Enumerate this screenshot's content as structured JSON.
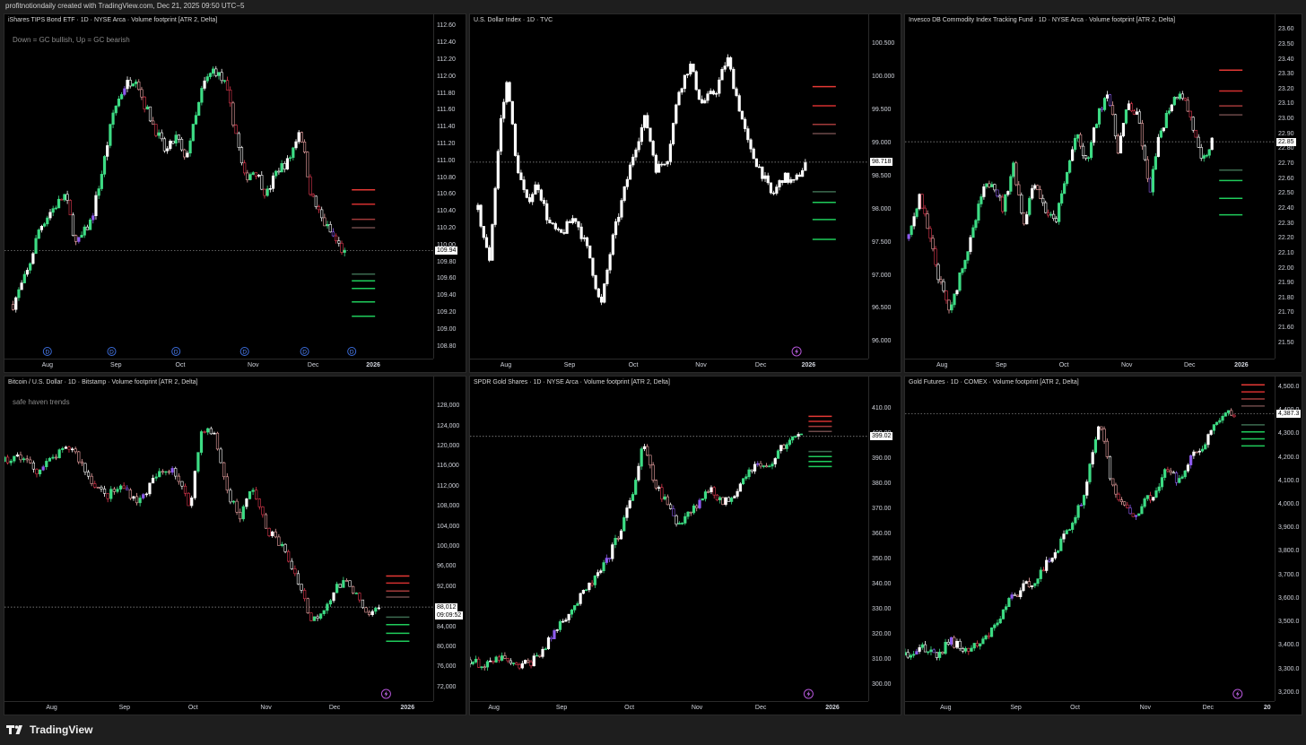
{
  "header": {
    "text": "profitnotiondaily created with TradingView.com, Dec 21, 2025 09:50 UTC−5"
  },
  "footer": {
    "brand": "TradingView"
  },
  "colors": {
    "bull": "#3ddc84",
    "bear": "#f2a7a7",
    "neutral": "#ffffff",
    "red_level": "#e53935",
    "green_level": "#1fcc5b",
    "purple": "#8e5cf0"
  },
  "panels": [
    {
      "id": "tip",
      "title": "iShares TIPS Bond ETF · 1D · NYSE Arca · Volume footprint [ATR 2, Delta]",
      "note": "Down = GC  bullish, Up =  GC bearish",
      "y_labels": [
        "112.60",
        "112.40",
        "112.20",
        "112.00",
        "111.80",
        "111.60",
        "111.40",
        "111.20",
        "111.00",
        "110.80",
        "110.60",
        "110.40",
        "110.20",
        "110.00",
        "109.80",
        "109.60",
        "109.40",
        "109.20",
        "109.00",
        "108.80"
      ],
      "price": "109.94",
      "x_labels": [
        "Aug",
        "Sep",
        "Oct",
        "Nov",
        "Dec",
        "2026"
      ],
      "marker_labels": [
        "D",
        "D",
        "D",
        "D",
        "D",
        "D"
      ]
    },
    {
      "id": "dxy",
      "title": "U.S. Dollar Index · 1D · TVC",
      "note": "",
      "y_labels": [
        "100.500",
        "100.000",
        "99.500",
        "99.000",
        "98.500",
        "98.000",
        "97.500",
        "97.000",
        "96.500",
        "96.000"
      ],
      "price": "98.718",
      "x_labels": [
        "Aug",
        "Sep",
        "Oct",
        "Nov",
        "Dec",
        "2026"
      ],
      "marker_labels": []
    },
    {
      "id": "dbc",
      "title": "Invesco DB Commodity Index Tracking Fund · 1D · NYSE Arca · Volume footprint [ATR 2, Delta]",
      "note": "",
      "y_labels": [
        "23.60",
        "23.50",
        "23.40",
        "23.30",
        "23.20",
        "23.10",
        "23.00",
        "22.90",
        "22.80",
        "22.70",
        "22.60",
        "22.50",
        "22.40",
        "22.30",
        "22.20",
        "22.10",
        "22.00",
        "21.90",
        "21.80",
        "21.70",
        "21.60",
        "21.50"
      ],
      "price": "22.85",
      "x_labels": [
        "Aug",
        "Sep",
        "Oct",
        "Nov",
        "Dec",
        "2026"
      ],
      "marker_labels": []
    },
    {
      "id": "btc",
      "title": "Bitcoin / U.S. Dollar · 1D · Bitstamp · Volume footprint [ATR 2, Delta]",
      "note": "safe haven trends",
      "y_labels": [
        "128,000",
        "124,000",
        "120,000",
        "116,000",
        "112,000",
        "108,000",
        "104,000",
        "100,000",
        "96,000",
        "92,000",
        "88,000",
        "84,000",
        "80,000",
        "76,000",
        "72,000"
      ],
      "price": "88,012",
      "countdown": "09:09:52",
      "x_labels": [
        "Aug",
        "Sep",
        "Oct",
        "Nov",
        "Dec",
        "2026"
      ],
      "marker_labels": []
    },
    {
      "id": "gld",
      "title": "SPDR Gold Shares · 1D · NYSE Arca · Volume footprint [ATR 2, Delta]",
      "note": "",
      "y_labels": [
        "410.00",
        "400.00",
        "390.00",
        "380.00",
        "370.00",
        "360.00",
        "350.00",
        "340.00",
        "330.00",
        "320.00",
        "310.00",
        "300.00"
      ],
      "price": "399.02",
      "x_labels": [
        "Aug",
        "Sep",
        "Oct",
        "Nov",
        "Dec",
        "2026"
      ],
      "marker_labels": []
    },
    {
      "id": "gc",
      "title": "Gold Futures · 1D · COMEX · Volume footprint [ATR 2, Delta]",
      "note": "",
      "y_labels": [
        "4,500.0",
        "4,400.0",
        "4,300.0",
        "4,200.0",
        "4,100.0",
        "4,000.0",
        "3,900.0",
        "3,800.0",
        "3,700.0",
        "3,600.0",
        "3,500.0",
        "3,400.0",
        "3,300.0",
        "3,200.0"
      ],
      "price": "4,387.3",
      "x_labels": [
        "Aug",
        "Sep",
        "Oct",
        "Nov",
        "Dec",
        "20"
      ],
      "marker_labels": []
    }
  ],
  "chart_data": [
    {
      "type": "candlestick",
      "title": "iShares TIPS Bond ETF · 1D · NYSE Arca · Volume footprint [ATR 2, Delta]",
      "ylim": [
        108.7,
        112.7
      ],
      "x_labels": [
        "Aug",
        "Sep",
        "Oct",
        "Nov",
        "Dec",
        "2026"
      ],
      "last_price": 109.94,
      "path": [
        [
          0,
          109.3
        ],
        [
          0.04,
          109.7
        ],
        [
          0.07,
          110.2
        ],
        [
          0.1,
          110.4
        ],
        [
          0.14,
          110.6
        ],
        [
          0.17,
          110.0
        ],
        [
          0.21,
          110.3
        ],
        [
          0.24,
          110.9
        ],
        [
          0.27,
          111.6
        ],
        [
          0.3,
          111.9
        ],
        [
          0.33,
          112.0
        ],
        [
          0.35,
          111.7
        ],
        [
          0.38,
          111.4
        ],
        [
          0.41,
          111.1
        ],
        [
          0.44,
          111.3
        ],
        [
          0.46,
          111.0
        ],
        [
          0.49,
          111.5
        ],
        [
          0.51,
          111.9
        ],
        [
          0.54,
          112.1
        ],
        [
          0.57,
          111.9
        ],
        [
          0.6,
          111.3
        ],
        [
          0.62,
          110.8
        ],
        [
          0.65,
          110.9
        ],
        [
          0.68,
          110.6
        ],
        [
          0.71,
          110.9
        ],
        [
          0.74,
          111.0
        ],
        [
          0.77,
          111.4
        ],
        [
          0.8,
          110.6
        ],
        [
          0.83,
          110.3
        ],
        [
          0.86,
          110.1
        ],
        [
          0.89,
          109.9
        ]
      ],
      "levels": {
        "red": [
          110.66,
          110.49,
          110.31,
          110.21
        ],
        "green": [
          109.66,
          109.58,
          109.49,
          109.33,
          109.16
        ]
      }
    },
    {
      "type": "candlestick",
      "title": "U.S. Dollar Index · 1D · TVC",
      "ylim": [
        95.8,
        100.9
      ],
      "x_labels": [
        "Aug",
        "Sep",
        "Oct",
        "Nov",
        "Dec",
        "2026"
      ],
      "last_price": 98.718,
      "path": [
        [
          0,
          98.0
        ],
        [
          0.03,
          97.2
        ],
        [
          0.06,
          99.3
        ],
        [
          0.08,
          100.0
        ],
        [
          0.1,
          98.8
        ],
        [
          0.13,
          98.1
        ],
        [
          0.16,
          98.4
        ],
        [
          0.19,
          97.8
        ],
        [
          0.22,
          97.6
        ],
        [
          0.26,
          97.9
        ],
        [
          0.3,
          97.3
        ],
        [
          0.33,
          96.5
        ],
        [
          0.36,
          97.5
        ],
        [
          0.39,
          98.2
        ],
        [
          0.42,
          98.9
        ],
        [
          0.45,
          99.4
        ],
        [
          0.48,
          98.6
        ],
        [
          0.51,
          98.8
        ],
        [
          0.54,
          99.8
        ],
        [
          0.57,
          100.2
        ],
        [
          0.6,
          99.6
        ],
        [
          0.64,
          99.8
        ],
        [
          0.67,
          100.3
        ],
        [
          0.7,
          99.6
        ],
        [
          0.73,
          98.9
        ],
        [
          0.76,
          98.6
        ],
        [
          0.79,
          98.2
        ],
        [
          0.82,
          98.5
        ],
        [
          0.85,
          98.4
        ],
        [
          0.88,
          98.7
        ]
      ],
      "levels": {
        "red": [
          99.86,
          99.57,
          99.29,
          99.15
        ],
        "green": [
          98.27,
          98.11,
          97.85,
          97.55
        ]
      }
    },
    {
      "type": "candlestick",
      "title": "Invesco DB Commodity Index Tracking Fund · 1D · NYSE Arca · Volume footprint [ATR 2, Delta]",
      "ylim": [
        21.42,
        23.68
      ],
      "x_labels": [
        "Aug",
        "Sep",
        "Oct",
        "Nov",
        "Dec",
        "2026"
      ],
      "last_price": 22.85,
      "path": [
        [
          0,
          22.2
        ],
        [
          0.03,
          22.5
        ],
        [
          0.06,
          22.2
        ],
        [
          0.09,
          21.9
        ],
        [
          0.12,
          21.7
        ],
        [
          0.15,
          22.0
        ],
        [
          0.18,
          22.2
        ],
        [
          0.21,
          22.5
        ],
        [
          0.24,
          22.6
        ],
        [
          0.27,
          22.4
        ],
        [
          0.3,
          22.7
        ],
        [
          0.33,
          22.3
        ],
        [
          0.36,
          22.6
        ],
        [
          0.39,
          22.4
        ],
        [
          0.42,
          22.3
        ],
        [
          0.45,
          22.6
        ],
        [
          0.48,
          22.9
        ],
        [
          0.51,
          22.7
        ],
        [
          0.54,
          23.0
        ],
        [
          0.57,
          23.2
        ],
        [
          0.6,
          22.8
        ],
        [
          0.63,
          23.1
        ],
        [
          0.66,
          23.0
        ],
        [
          0.69,
          22.5
        ],
        [
          0.72,
          22.9
        ],
        [
          0.75,
          23.1
        ],
        [
          0.78,
          23.2
        ],
        [
          0.81,
          23.0
        ],
        [
          0.84,
          22.7
        ],
        [
          0.87,
          22.85
        ]
      ],
      "levels": {
        "red": [
          23.33,
          23.19,
          23.09,
          23.03
        ],
        "green": [
          22.66,
          22.59,
          22.47,
          22.36
        ]
      }
    },
    {
      "type": "candlestick",
      "title": "Bitcoin / U.S. Dollar · 1D · Bitstamp · Volume footprint [ATR 2, Delta]",
      "ylim": [
        70000,
        130000
      ],
      "x_labels": [
        "Aug",
        "Sep",
        "Oct",
        "Nov",
        "Dec",
        "2026"
      ],
      "last_price": 88012,
      "path": [
        [
          0,
          117000
        ],
        [
          0.04,
          118000
        ],
        [
          0.08,
          115000
        ],
        [
          0.12,
          118000
        ],
        [
          0.16,
          120000
        ],
        [
          0.2,
          114000
        ],
        [
          0.24,
          110000
        ],
        [
          0.28,
          112000
        ],
        [
          0.32,
          109000
        ],
        [
          0.36,
          114000
        ],
        [
          0.4,
          116000
        ],
        [
          0.44,
          108000
        ],
        [
          0.47,
          124000
        ],
        [
          0.5,
          122000
        ],
        [
          0.53,
          111000
        ],
        [
          0.56,
          106000
        ],
        [
          0.59,
          112000
        ],
        [
          0.62,
          104000
        ],
        [
          0.66,
          100000
        ],
        [
          0.7,
          93000
        ],
        [
          0.73,
          85000
        ],
        [
          0.76,
          88000
        ],
        [
          0.79,
          92000
        ],
        [
          0.82,
          93000
        ],
        [
          0.86,
          86000
        ],
        [
          0.89,
          88000
        ]
      ],
      "levels": {
        "red": [
          94200,
          92800,
          91200,
          90000
        ],
        "green": [
          86000,
          84500,
          82800,
          81200
        ]
      }
    },
    {
      "type": "candlestick",
      "title": "SPDR Gold Shares · 1D · NYSE Arca · Volume footprint [ATR 2, Delta]",
      "ylim": [
        295,
        415
      ],
      "x_labels": [
        "Aug",
        "Sep",
        "Oct",
        "Nov",
        "Dec",
        "2026"
      ],
      "last_price": 399.02,
      "path": [
        [
          0,
          310
        ],
        [
          0.04,
          307
        ],
        [
          0.08,
          311
        ],
        [
          0.12,
          307
        ],
        [
          0.16,
          309
        ],
        [
          0.2,
          315
        ],
        [
          0.24,
          325
        ],
        [
          0.28,
          332
        ],
        [
          0.32,
          340
        ],
        [
          0.36,
          348
        ],
        [
          0.4,
          362
        ],
        [
          0.43,
          375
        ],
        [
          0.46,
          396
        ],
        [
          0.49,
          380
        ],
        [
          0.52,
          373
        ],
        [
          0.55,
          364
        ],
        [
          0.58,
          369
        ],
        [
          0.61,
          373
        ],
        [
          0.64,
          379
        ],
        [
          0.67,
          372
        ],
        [
          0.7,
          376
        ],
        [
          0.73,
          384
        ],
        [
          0.76,
          388
        ],
        [
          0.79,
          386
        ],
        [
          0.82,
          393
        ],
        [
          0.85,
          398
        ],
        [
          0.88,
          399
        ]
      ],
      "levels": {
        "red": [
          407,
          405,
          403,
          401
        ],
        "green": [
          393,
          391,
          389,
          387
        ]
      }
    },
    {
      "type": "candlestick",
      "title": "Gold Futures · 1D · COMEX · Volume footprint [ATR 2, Delta]",
      "ylim": [
        3180,
        4530
      ],
      "x_labels": [
        "Aug",
        "Sep",
        "Oct",
        "Nov",
        "Dec",
        "20"
      ],
      "last_price": 4387.3,
      "path": [
        [
          0,
          3360
        ],
        [
          0.04,
          3400
        ],
        [
          0.08,
          3350
        ],
        [
          0.12,
          3420
        ],
        [
          0.16,
          3380
        ],
        [
          0.2,
          3400
        ],
        [
          0.24,
          3480
        ],
        [
          0.28,
          3600
        ],
        [
          0.32,
          3650
        ],
        [
          0.36,
          3700
        ],
        [
          0.4,
          3800
        ],
        [
          0.44,
          3900
        ],
        [
          0.48,
          4050
        ],
        [
          0.52,
          4370
        ],
        [
          0.55,
          4100
        ],
        [
          0.58,
          4000
        ],
        [
          0.61,
          3950
        ],
        [
          0.64,
          4010
        ],
        [
          0.67,
          4060
        ],
        [
          0.7,
          4150
        ],
        [
          0.73,
          4100
        ],
        [
          0.76,
          4200
        ],
        [
          0.79,
          4230
        ],
        [
          0.82,
          4320
        ],
        [
          0.85,
          4380
        ],
        [
          0.88,
          4387
        ]
      ],
      "levels": {
        "red": [
          4510,
          4480,
          4450,
          4420
        ],
        "green": [
          4340,
          4310,
          4280,
          4250
        ]
      }
    }
  ]
}
